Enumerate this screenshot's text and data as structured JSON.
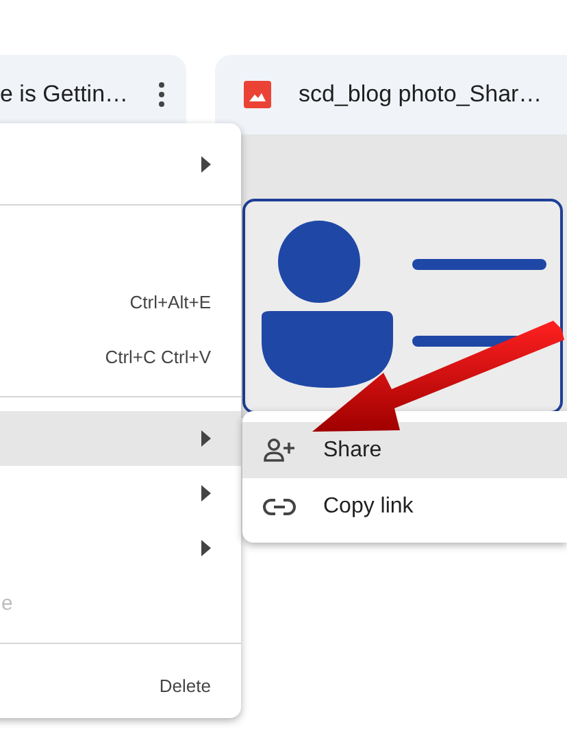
{
  "files": [
    {
      "title": "e is Gettin…",
      "more_button": true,
      "kind": "doc"
    },
    {
      "title": "scd_blog photo_Shar…",
      "more_button": false,
      "kind": "image"
    }
  ],
  "context_menu": {
    "items": [
      {
        "kind": "entry",
        "submenu": true,
        "selected": false,
        "disabled": false
      },
      {
        "kind": "divider"
      },
      {
        "kind": "blank"
      },
      {
        "kind": "entry",
        "shortcut": "Ctrl+Alt+E",
        "submenu": false,
        "selected": false,
        "disabled": false
      },
      {
        "kind": "entry",
        "shortcut": "Ctrl+C Ctrl+V",
        "submenu": false,
        "selected": false,
        "disabled": false
      },
      {
        "kind": "divider"
      },
      {
        "kind": "entry",
        "submenu": true,
        "selected": true,
        "disabled": false
      },
      {
        "kind": "entry",
        "submenu": true,
        "selected": false,
        "disabled": false
      },
      {
        "kind": "entry",
        "submenu": true,
        "selected": false,
        "disabled": false
      },
      {
        "kind": "entry",
        "label": "e",
        "submenu": false,
        "selected": false,
        "disabled": true
      },
      {
        "kind": "divider"
      },
      {
        "kind": "entry",
        "shortcut": "Delete",
        "submenu": false,
        "selected": false,
        "disabled": false
      }
    ]
  },
  "submenu": {
    "items": [
      {
        "kind": "share",
        "label": "Share",
        "selected": true
      },
      {
        "kind": "link",
        "label": "Copy link",
        "selected": false
      }
    ]
  },
  "annotation": {
    "kind": "arrow"
  }
}
